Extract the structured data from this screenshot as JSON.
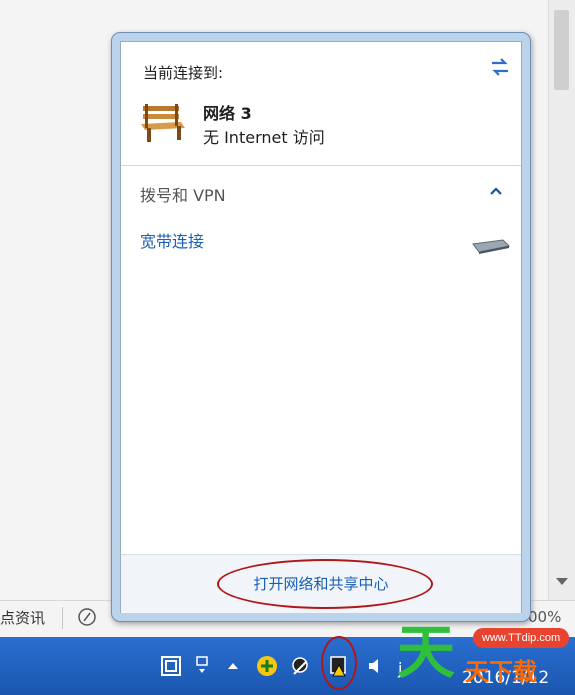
{
  "popup": {
    "title": "当前连接到:",
    "network": {
      "name": "网络  3",
      "status": "无 Internet 访问"
    },
    "section": {
      "label": "拨号和 VPN"
    },
    "connection": {
      "label": "宽带连接"
    },
    "footer_link": "打开网络和共享中心"
  },
  "background": {
    "news_label": "点资讯",
    "zoom_percent": "00%"
  },
  "taskbar": {
    "clock_fragment": "j",
    "date": "2016/1/12"
  },
  "watermark": {
    "domain": "www.TTdip.com",
    "big_char": "天",
    "small_text": "天下载"
  },
  "colors": {
    "link": "#1a5fb4",
    "annotation": "#b01818",
    "taskbar": "#2a6fd0"
  }
}
